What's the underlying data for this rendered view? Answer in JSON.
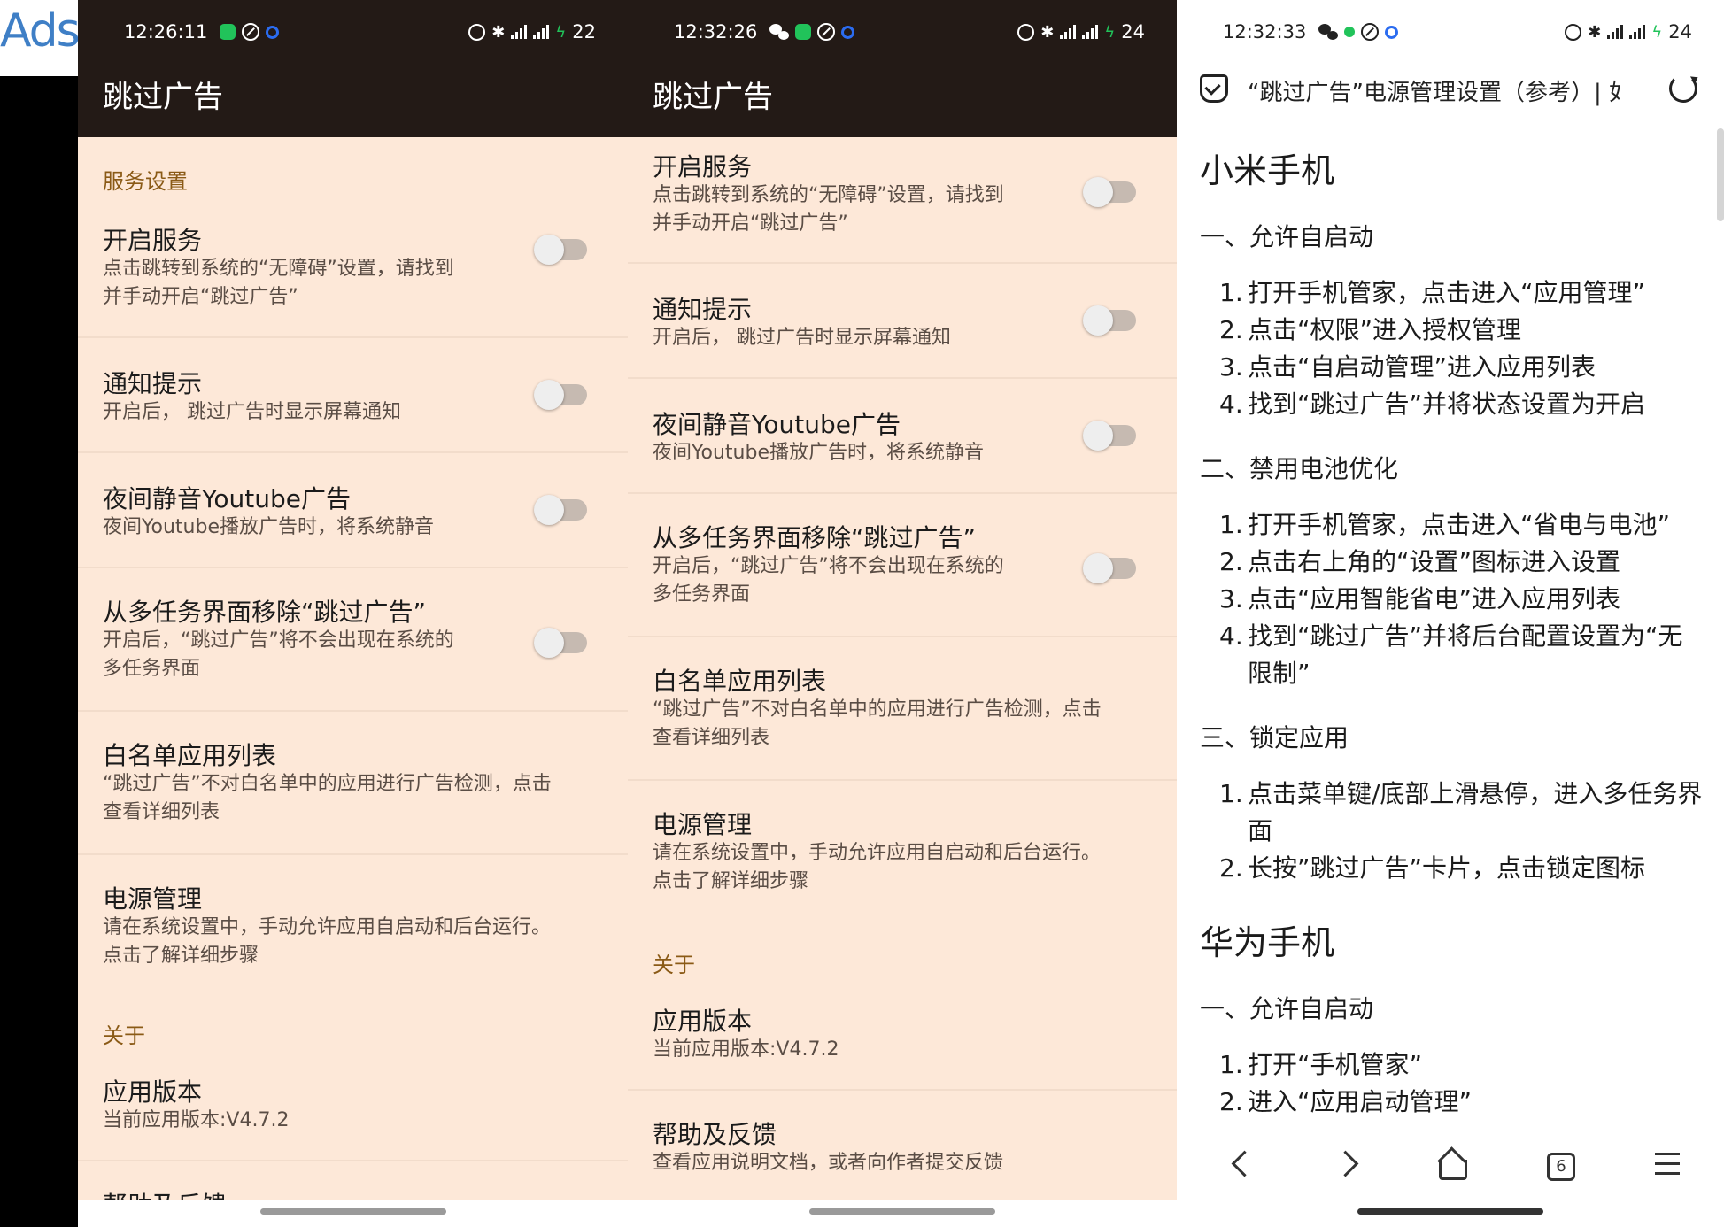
{
  "ads_text": "Ads-",
  "panel1": {
    "time": "12:26:11",
    "battery": "22",
    "app_title": "跳过广告",
    "section_service": "服务设置",
    "items": [
      {
        "title": "开启服务",
        "sub": "点击跳转到系统的“无障碍”设置，请找到\n并手动开启“跳过广告”"
      },
      {
        "title": "通知提示",
        "sub": "开启后， 跳过广告时显示屏幕通知"
      },
      {
        "title": "夜间静音Youtube广告",
        "sub": "夜间Youtube播放广告时，将系统静音"
      },
      {
        "title": "从多任务界面移除“跳过广告”",
        "sub": "开启后，“跳过广告”将不会出现在系统的\n多任务界面"
      },
      {
        "title": "白名单应用列表",
        "sub": "“跳过广告”不对白名单中的应用进行广告检测，点击\n查看详细列表"
      },
      {
        "title": "电源管理",
        "sub": "请在系统设置中，手动允许应用自启动和后台运行。\n点击了解详细步骤"
      }
    ],
    "section_about": "关于",
    "about": {
      "title": "应用版本",
      "sub": "当前应用版本:V4.7.2"
    },
    "cut_title": "帮助及反馈"
  },
  "panel2": {
    "time": "12:32:26",
    "battery": "24",
    "app_title": "跳过广告",
    "items": [
      {
        "title": "开启服务",
        "sub": "点击跳转到系统的“无障碍”设置，请找到\n并手动开启“跳过广告”"
      },
      {
        "title": "通知提示",
        "sub": "开启后， 跳过广告时显示屏幕通知"
      },
      {
        "title": "夜间静音Youtube广告",
        "sub": "夜间Youtube播放广告时，将系统静音"
      },
      {
        "title": "从多任务界面移除“跳过广告”",
        "sub": "开启后，“跳过广告”将不会出现在系统的\n多任务界面"
      },
      {
        "title": "白名单应用列表",
        "sub": "“跳过广告”不对白名单中的应用进行广告检测，点击\n查看详细列表"
      },
      {
        "title": "电源管理",
        "sub": "请在系统设置中，手动允许应用自启动和后台运行。\n点击了解详细步骤"
      }
    ],
    "section_about": "关于",
    "about": [
      {
        "title": "应用版本",
        "sub": "当前应用版本:V4.7.2"
      },
      {
        "title": "帮助及反馈",
        "sub": "查看应用说明文档，或者向作者提交反馈"
      }
    ]
  },
  "panel3": {
    "time": "12:32:33",
    "battery": "24",
    "page_title": "“跳过广告”电源管理设置（参考）| 如",
    "tab_count": "6",
    "doc": {
      "brand1": "小米手机",
      "s1": "一、允许自启动",
      "s1_steps": [
        "打开手机管家，点击进入“应用管理”",
        "点击“权限”进入授权管理",
        "点击“自启动管理”进入应用列表",
        "找到“跳过广告”并将状态设置为开启"
      ],
      "s2": "二、禁用电池优化",
      "s2_steps": [
        "打开手机管家，点击进入“省电与电池”",
        "点击右上角的“设置”图标进入设置",
        "点击“应用智能省电”进入应用列表",
        "找到“跳过广告”并将后台配置设置为“无限制”"
      ],
      "s3": "三、锁定应用",
      "s3_steps": [
        "点击菜单键/底部上滑悬停，进入多任务界面",
        "长按”跳过广告”卡片，点击锁定图标"
      ],
      "brand2": "华为手机",
      "h_s1": "一、允许自启动",
      "h_steps": [
        "打开“手机管家”",
        "进入“应用启动管理”"
      ]
    }
  },
  "colors": {
    "appbar": "#231a16",
    "panel_bg": "#fde8d8",
    "section": "#8a5a16",
    "toggle_track": "#c6bab1"
  }
}
